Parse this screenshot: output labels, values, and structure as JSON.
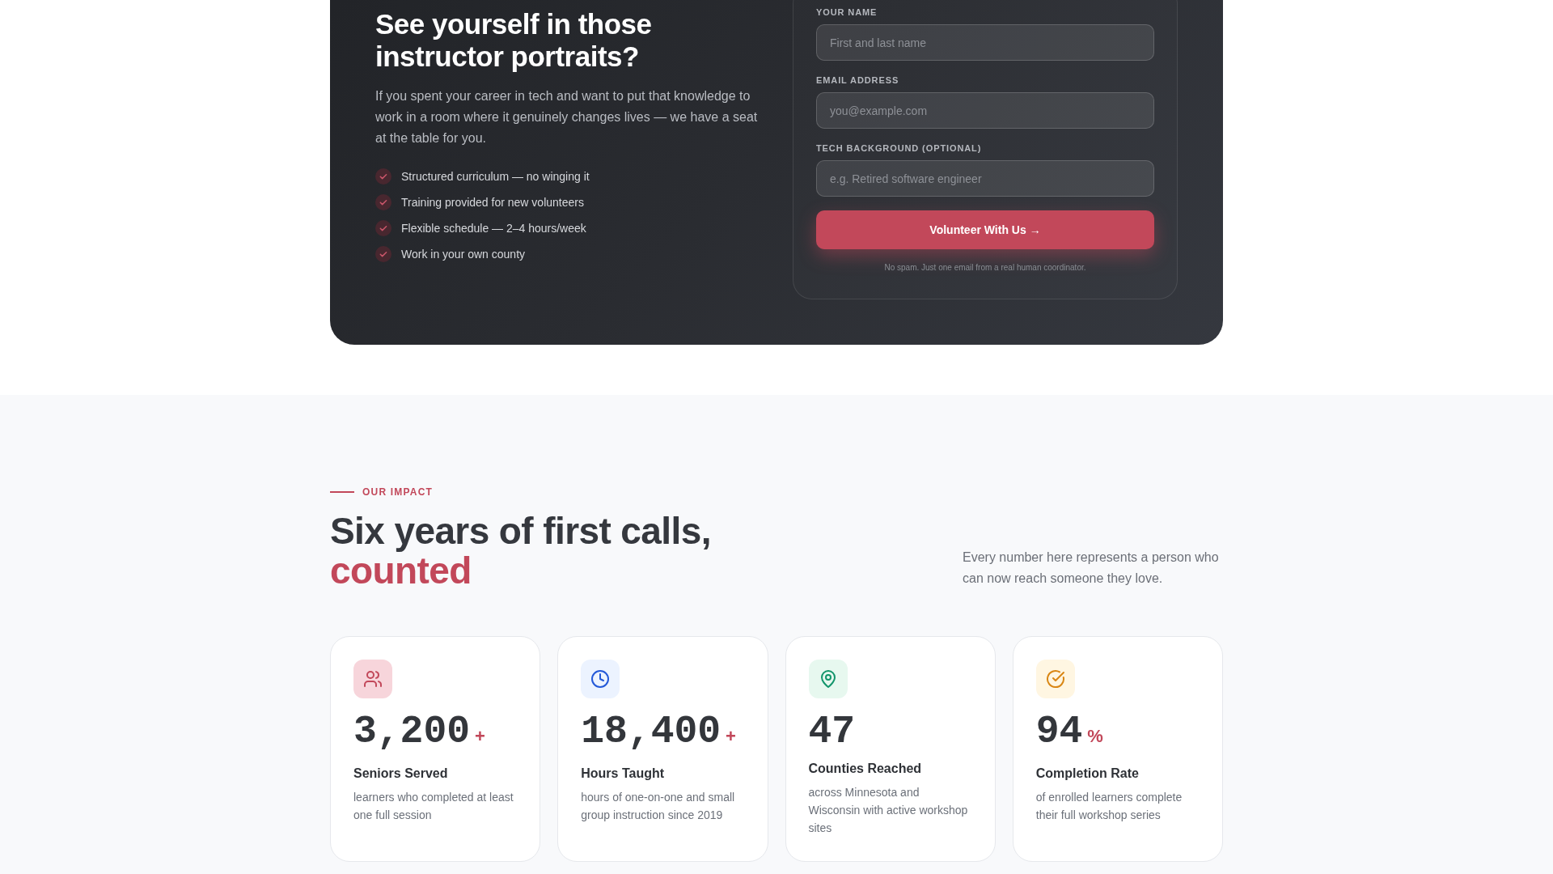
{
  "cta": {
    "heading": "See yourself in those instructor portraits?",
    "description": "If you spent your career in tech and want to put that knowledge to work in a room where it genuinely changes lives — we have a seat at the table for you.",
    "benefits": [
      "Structured curriculum — no winging it",
      "Training provided for new volunteers",
      "Flexible schedule — 2–4 hours/week",
      "Work in your own county"
    ]
  },
  "form": {
    "fields": [
      {
        "label": "YOUR NAME",
        "placeholder": "First and last name"
      },
      {
        "label": "EMAIL ADDRESS",
        "placeholder": "you@example.com"
      },
      {
        "label": "TECH BACKGROUND (OPTIONAL)",
        "placeholder": "e.g. Retired software engineer"
      }
    ],
    "submit_button": "Volunteer With Us →",
    "note": "No spam. Just one email from a real human coordinator."
  },
  "impact": {
    "eyebrow": "OUR IMPACT",
    "heading": "Six years of first calls,",
    "heading_accent": "counted",
    "description": "Every number here represents a person who can now reach someone they love.",
    "stats": [
      {
        "kind": "people",
        "value": "3,200",
        "suffix": "+",
        "label": "Seniors Served",
        "description": "learners who completed at least one full session"
      },
      {
        "kind": "clock",
        "value": "18,400",
        "suffix": "+",
        "label": "Hours Taught",
        "description": "hours of one-on-one and small group instruction since 2019"
      },
      {
        "kind": "pin",
        "value": "47",
        "label": "Counties Reached",
        "description": "across Minnesota and Wisconsin with active workshop sites"
      },
      {
        "kind": "check",
        "value": "94",
        "suffix": "%",
        "label": "Completion Rate",
        "description": "of enrolled learners complete their full workshop series"
      }
    ]
  }
}
